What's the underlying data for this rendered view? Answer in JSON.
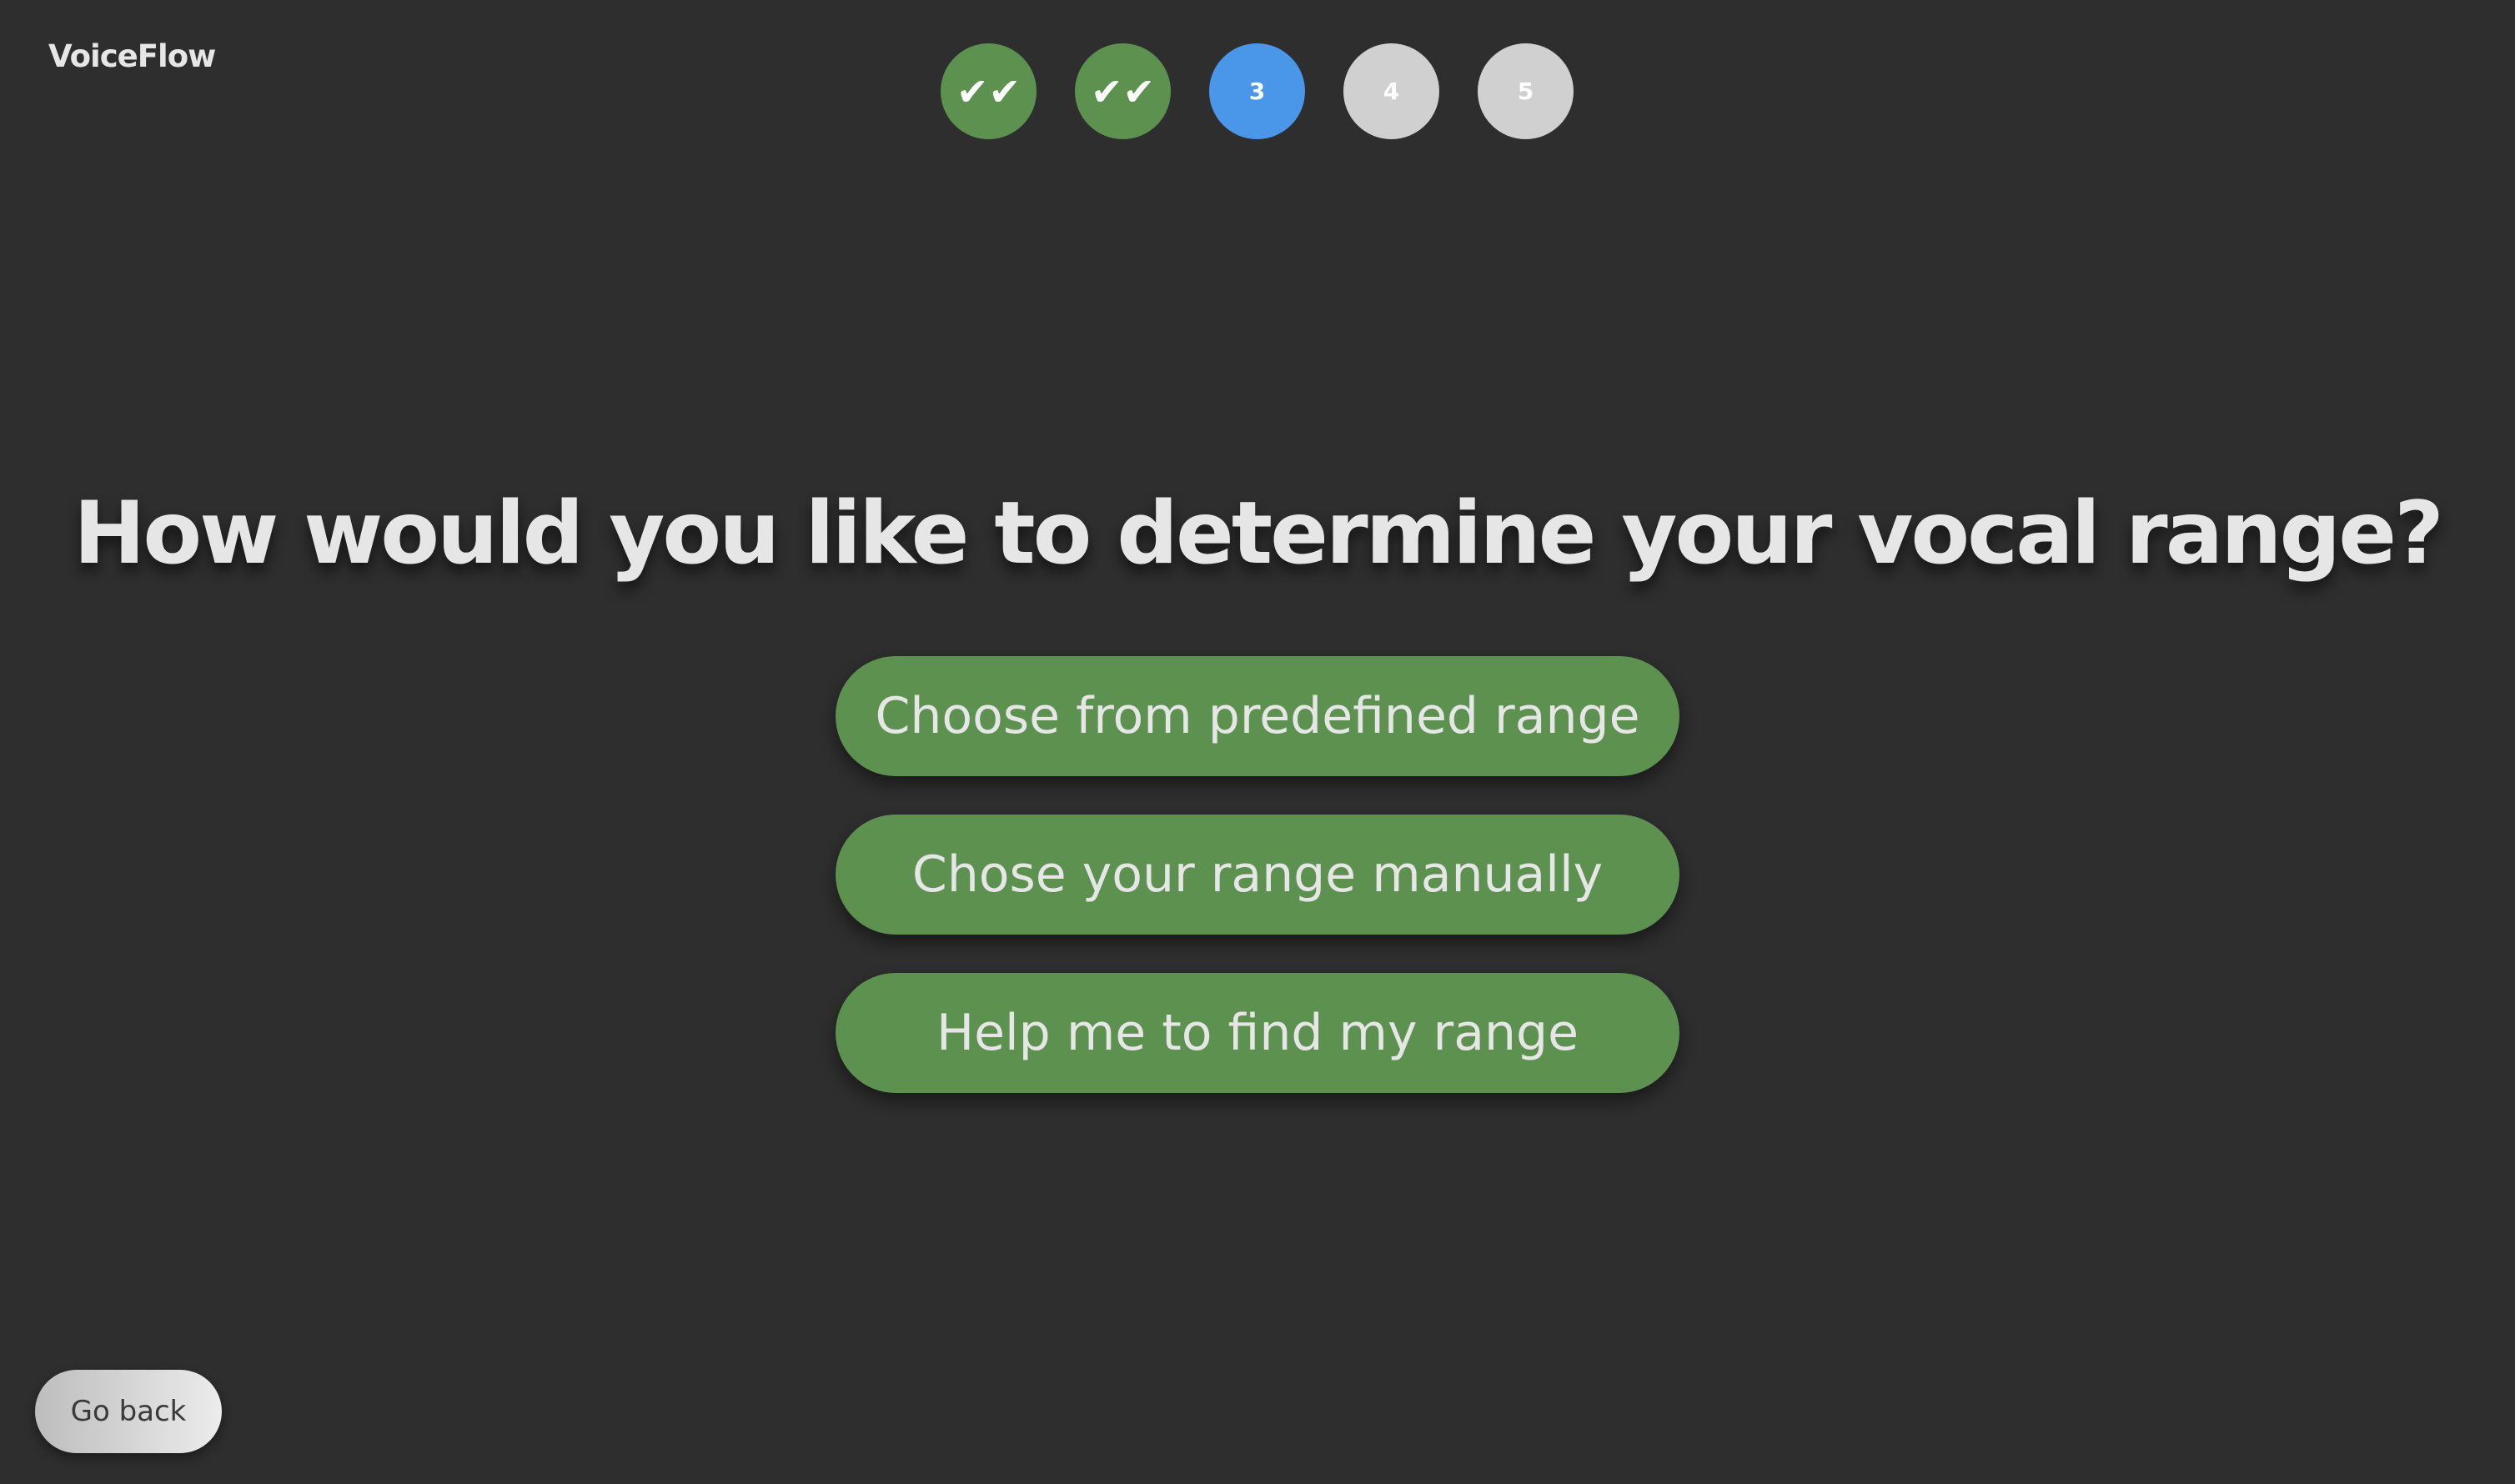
{
  "app": {
    "logo_text": "VoiceFlow"
  },
  "stepper": {
    "steps": [
      {
        "label": "✔✔",
        "state": "completed"
      },
      {
        "label": "✔✔",
        "state": "completed"
      },
      {
        "label": "3",
        "state": "current"
      },
      {
        "label": "4",
        "state": "pending"
      },
      {
        "label": "5",
        "state": "pending"
      }
    ]
  },
  "main": {
    "question": "How would you like to determine your vocal range?",
    "options": [
      {
        "label": "Choose from predefined range"
      },
      {
        "label": "Chose your range manually"
      },
      {
        "label": "Help me to find my range"
      }
    ]
  },
  "footer": {
    "go_back_label": "Go back"
  },
  "colors": {
    "background": "#2e2e2e",
    "completed_step": "#5d914f",
    "current_step": "#4a97ea",
    "pending_step": "#d0d0d0",
    "option_button": "#5d914f",
    "text": "#e6e6e6"
  }
}
